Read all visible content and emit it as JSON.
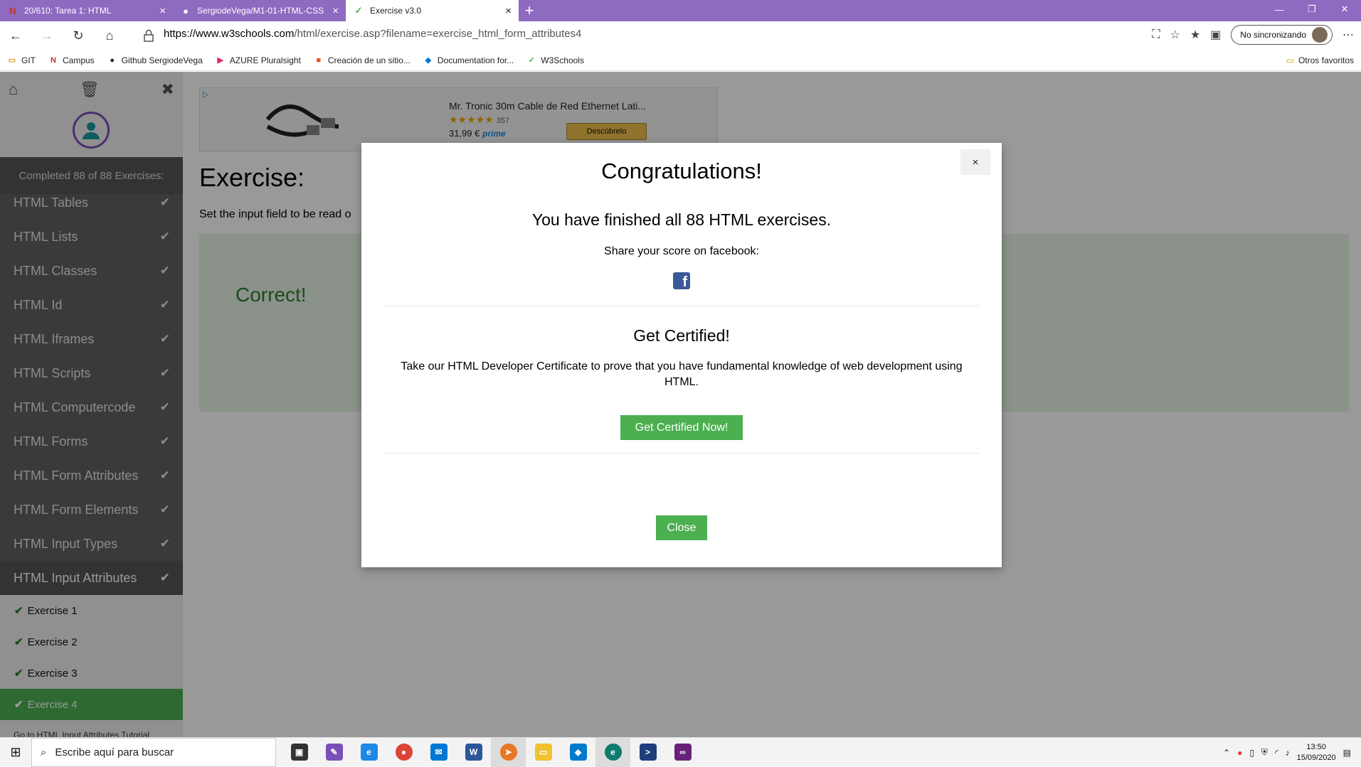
{
  "tabs": [
    {
      "label": "20/610: Tarea 1: HTML",
      "favicon": "N"
    },
    {
      "label": "SergiodeVega/M1-01-HTML-CSS",
      "favicon": "github"
    },
    {
      "label": "Exercise v3.0",
      "favicon": "w3"
    }
  ],
  "address": {
    "host": "https://www.w3schools.com",
    "path": "/html/exercise.asp?filename=exercise_html_form_attributes4"
  },
  "sync_label": "No sincronizando",
  "bookmarks": [
    "GIT",
    "Campus",
    "Github SergiodeVega",
    "AZURE Pluralsight",
    "Creación de un sitio...",
    "Documentation for...",
    "W3Schools"
  ],
  "bookmarks_other": "Otros favoritos",
  "sidebar": {
    "completed": "Completed 88 of 88 Exercises:",
    "items": [
      "HTML Tables",
      "HTML Lists",
      "HTML Classes",
      "HTML Id",
      "HTML Iframes",
      "HTML Scripts",
      "HTML Computercode",
      "HTML Forms",
      "HTML Form Attributes",
      "HTML Form Elements",
      "HTML Input Types",
      "HTML Input Attributes"
    ],
    "subitems": [
      "Exercise 1",
      "Exercise 2",
      "Exercise 3",
      "Exercise 4"
    ],
    "tutorial_link": "Go to HTML Input Attributes Tutorial"
  },
  "ad": {
    "title": "Mr. Tronic 30m Cable de Red Ethernet Lati...",
    "rating_count": "357",
    "price": "31,99 €",
    "prime": "prime",
    "button": "Descúbrelo"
  },
  "exercise": {
    "title": "Exercise:",
    "description": "Set the input field to be read o",
    "result": "Correct!"
  },
  "modal": {
    "close_x": "×",
    "title": "Congratulations!",
    "finished": "You have finished all 88 HTML exercises.",
    "share": "Share your score on facebook:",
    "cert_title": "Get Certified!",
    "cert_desc": "Take our HTML Developer Certificate to prove that you have fundamental knowledge of web development using HTML.",
    "cert_button": "Get Certified Now!",
    "close_button": "Close"
  },
  "taskbar": {
    "search_placeholder": "Escribe aquí para buscar",
    "time": "13:50",
    "date": "15/09/2020"
  },
  "colors": {
    "tabbar": "#8e6ac1",
    "sidebar": "#616161",
    "green": "#4caf50",
    "correct_bg": "#e7f4e4"
  }
}
